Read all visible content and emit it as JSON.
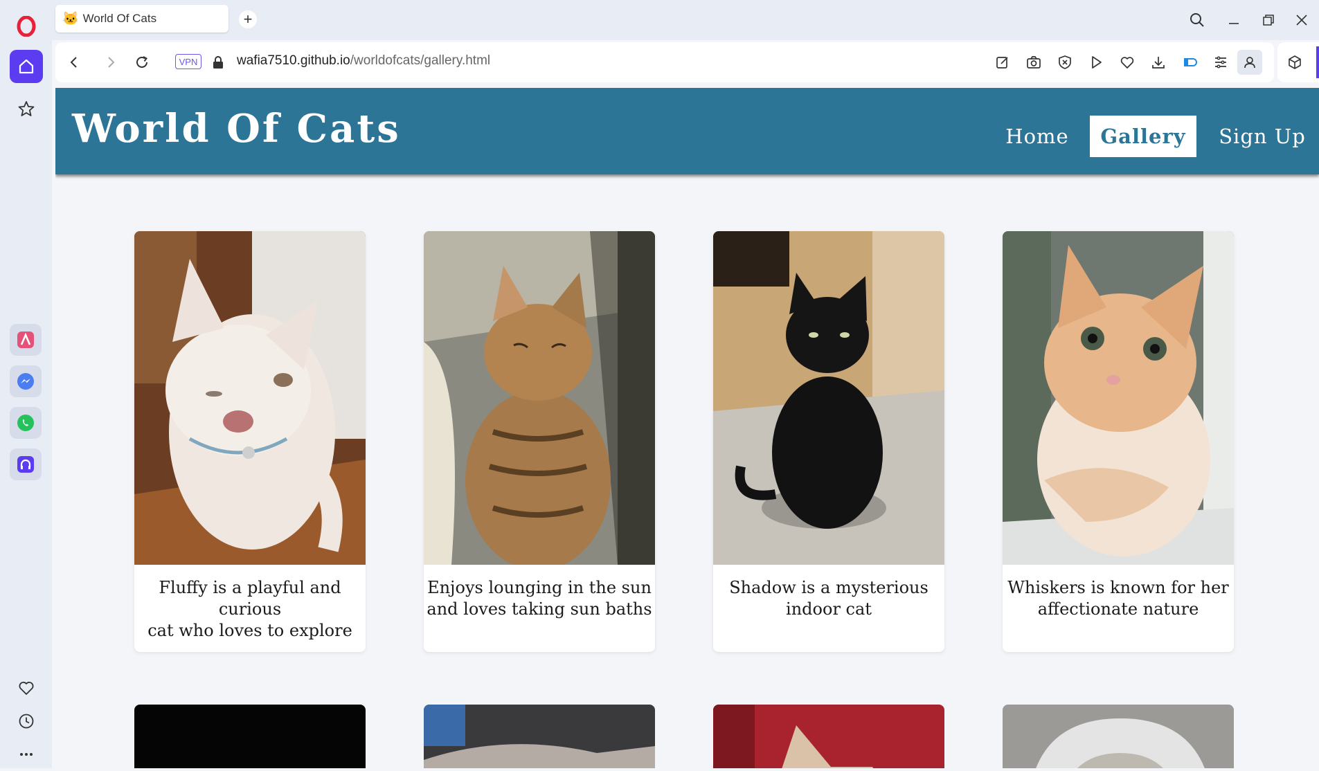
{
  "browser": {
    "tab_title": "World Of Cats",
    "new_tab_label": "+",
    "vpn_label": "VPN",
    "url_host": "wafia7510.github.io",
    "url_path": "/worldofcats/gallery.html"
  },
  "site": {
    "title": "World Of Cats",
    "nav": [
      {
        "label": "Home",
        "active": false
      },
      {
        "label": "Gallery",
        "active": true
      },
      {
        "label": "Sign Up",
        "active": false
      }
    ]
  },
  "gallery": {
    "cards": [
      {
        "caption_line1": "Fluffy is a playful and curious",
        "caption_line2": "cat who loves to explore"
      },
      {
        "caption_line1": "Enjoys lounging in the sun",
        "caption_line2": "and loves taking sun baths"
      },
      {
        "caption_line1": "Shadow is a mysterious",
        "caption_line2": "indoor cat"
      },
      {
        "caption_line1": "Whiskers is known for her",
        "caption_line2": "affectionate nature"
      }
    ]
  },
  "colors": {
    "header": "#2c7596",
    "page_bg": "#f3f5f9",
    "opera_accent": "#5b3cf0"
  }
}
